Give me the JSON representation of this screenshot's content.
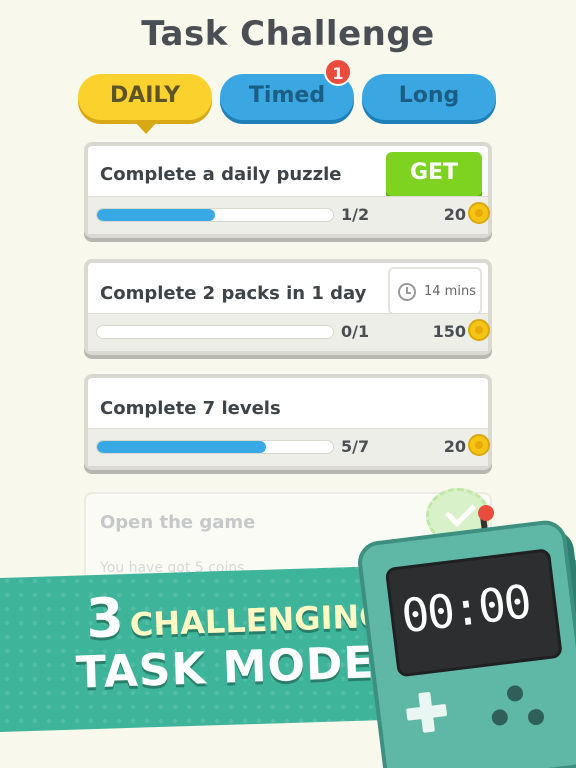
{
  "header": {
    "title": "Task Challenge"
  },
  "tabs": [
    {
      "label": "DAILY",
      "active": true
    },
    {
      "label": "Timed",
      "badge": "1"
    },
    {
      "label": "Long"
    }
  ],
  "tasks": [
    {
      "title": "Complete a daily puzzle",
      "progress_text": "1/2",
      "progress": 0.5,
      "reward": "20",
      "action_label": "GET"
    },
    {
      "title": "Complete 2 packs in 1 day",
      "progress_text": "0/1",
      "progress": 0.0,
      "reward": "150",
      "timer": "14 mins"
    },
    {
      "title": "Complete 7 levels",
      "progress_text": "5/7",
      "progress": 0.714,
      "reward": "20"
    }
  ],
  "completed_task": {
    "title": "Open the game",
    "subtitle": "You have got 5 coins"
  },
  "promo": {
    "number": "3",
    "line1_word": "CHALLENGING",
    "line2": "TASK MODES"
  },
  "device": {
    "display": "00:00"
  },
  "colors": {
    "accent_yellow": "#fbd12d",
    "accent_blue": "#3aa7e3",
    "get_green": "#7ed321",
    "banner_teal": "#3eb59a"
  }
}
